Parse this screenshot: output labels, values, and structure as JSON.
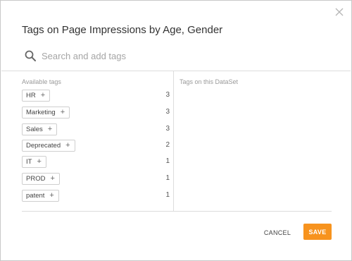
{
  "dialog": {
    "title": "Tags on Page Impressions by Age, Gender",
    "close_glyph": "✕"
  },
  "search": {
    "placeholder": "Search and add tags",
    "value": "",
    "icon": "search-icon"
  },
  "available": {
    "header": "Available tags",
    "tags": [
      {
        "label": "HR",
        "plus": "+",
        "count": "3"
      },
      {
        "label": "Marketing",
        "plus": "+",
        "count": "3"
      },
      {
        "label": "Sales",
        "plus": "+",
        "count": "3"
      },
      {
        "label": "Deprecated",
        "plus": "+",
        "count": "2"
      },
      {
        "label": "IT",
        "plus": "+",
        "count": "1"
      },
      {
        "label": "PROD",
        "plus": "+",
        "count": "1"
      },
      {
        "label": "patent",
        "plus": "+",
        "count": "1"
      }
    ]
  },
  "dataset": {
    "header": "Tags on this DataSet"
  },
  "footer": {
    "cancel_label": "CANCEL",
    "save_label": "SAVE"
  },
  "colors": {
    "accent": "#f7931e",
    "border": "#dcdcdc"
  }
}
